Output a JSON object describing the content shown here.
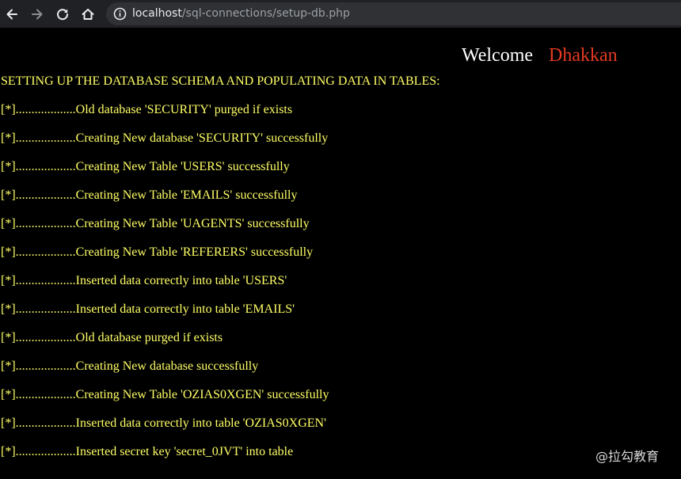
{
  "browser": {
    "url_host": "localhost",
    "url_path": "/sql-connections/setup-db.php",
    "icons": [
      "back-arrow-icon",
      "forward-arrow-icon",
      "reload-icon",
      "home-icon",
      "info-icon"
    ]
  },
  "header": {
    "welcome": "Welcome",
    "user": "Dhakkan"
  },
  "heading": "SETTING UP THE DATABASE SCHEMA AND POPULATING DATA IN TABLES:",
  "log": [
    "[*]...................Old database 'SECURITY' purged if exists",
    "[*]...................Creating New database 'SECURITY' successfully",
    "[*]...................Creating New Table 'USERS' successfully",
    "[*]...................Creating New Table 'EMAILS' successfully",
    "[*]...................Creating New Table 'UAGENTS' successfully",
    "[*]...................Creating New Table 'REFERERS' successfully",
    "[*]...................Inserted data correctly into table 'USERS'",
    "[*]...................Inserted data correctly into table 'EMAILS'",
    "[*]...................Old database purged if exists",
    "[*]...................Creating New database successfully",
    "[*]...................Creating New Table 'OZIAS0XGEN' successfully",
    "[*]...................Inserted data correctly into table 'OZIAS0XGEN'",
    "[*]...................Inserted secret key 'secret_0JVT' into table"
  ],
  "watermark": "@拉勾教育",
  "colors": {
    "page_bg": "#000000",
    "text_yellow": "#ffff66",
    "welcome_white": "#ffffff",
    "user_red": "#e53a22",
    "toolbar_bg": "#202124",
    "urlbar_bg": "#303134"
  }
}
